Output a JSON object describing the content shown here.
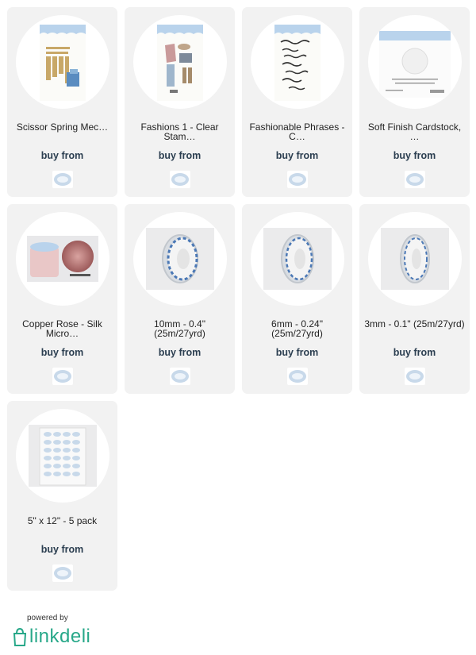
{
  "products": [
    {
      "name": "Scissor Spring Mec…",
      "buy": "buy from",
      "image": "die-set-package-icon"
    },
    {
      "name": "Fashions 1 - Clear Stam…",
      "buy": "buy from",
      "image": "clear-stamp-fashion-icon"
    },
    {
      "name": "Fashionable Phrases - C…",
      "buy": "buy from",
      "image": "clear-stamp-phrases-icon"
    },
    {
      "name": "Soft Finish Cardstock, …",
      "buy": "buy from",
      "image": "cardstock-package-icon"
    },
    {
      "name": "Copper Rose - Silk Micro…",
      "buy": "buy from",
      "image": "glitter-jar-icon"
    },
    {
      "name": "10mm - 0.4\" (25m/27yrd)",
      "buy": "buy from",
      "image": "tape-roll-icon"
    },
    {
      "name": "6mm - 0.24\" (25m/27yrd)",
      "buy": "buy from",
      "image": "tape-roll-icon"
    },
    {
      "name": "3mm - 0.1\" (25m/27yrd)",
      "buy": "buy from",
      "image": "tape-roll-icon"
    },
    {
      "name": "5\" x 12\" - 5 pack",
      "buy": "buy from",
      "image": "adhesive-sheet-icon"
    }
  ],
  "footer": {
    "powered_by": "powered by",
    "brand": "linkdeli"
  },
  "colors": {
    "card_bg": "#f2f2f2",
    "buy_text": "#2b3e50",
    "brand": "#28a889",
    "store_logo": "#c8d9ea"
  }
}
